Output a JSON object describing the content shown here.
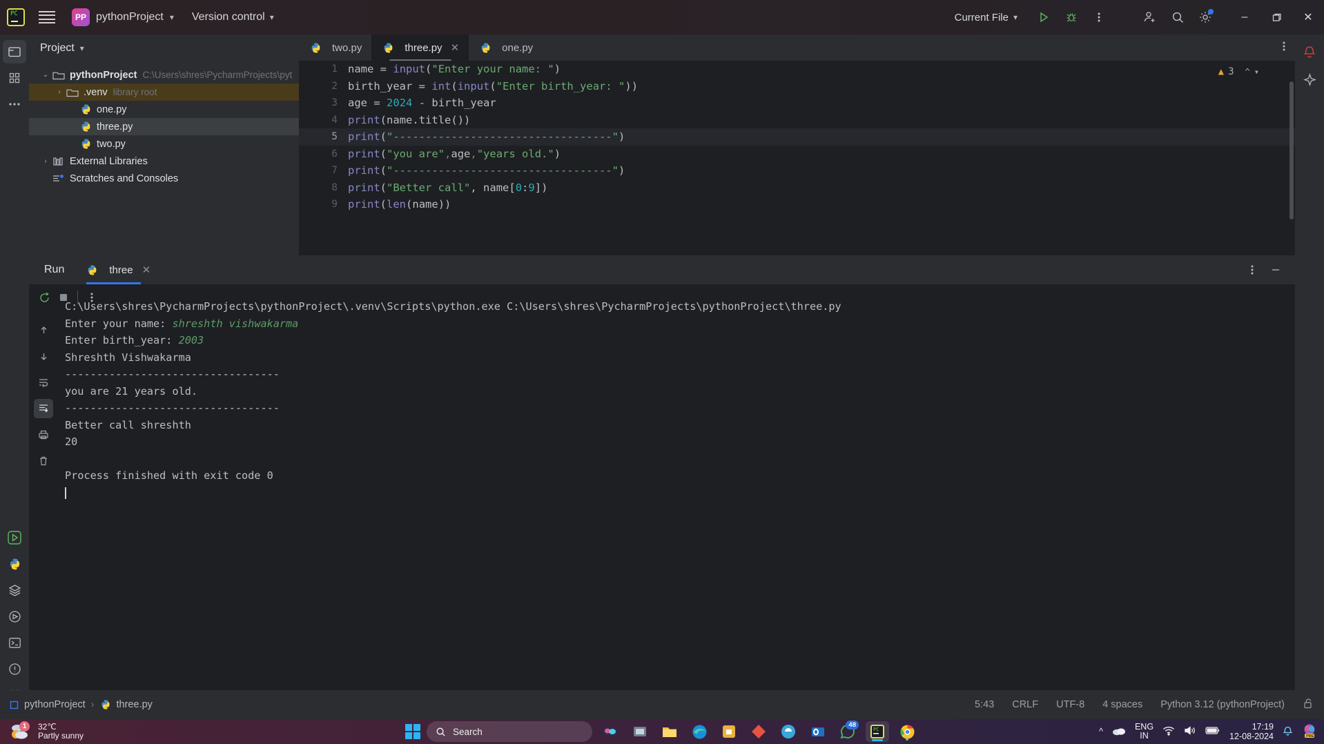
{
  "titlebar": {
    "logo_icon": "pycharm-logo-icon",
    "menu_icon": "hamburger-menu-icon",
    "project_initials": "PP",
    "project_name": "pythonProject",
    "version_control": "Version control",
    "run_config": "Current File",
    "run_icon": "run-triangle-icon",
    "debug_icon": "debug-bug-icon",
    "more_icon": "more-vertical-icon",
    "account_icon": "add-user-icon",
    "search_icon": "search-icon",
    "settings_icon": "gear-icon",
    "minimize": "–",
    "maximize": "❐",
    "close": "✕"
  },
  "toolstrip": {
    "items": [
      {
        "name": "project-icon",
        "label": "Project"
      },
      {
        "name": "structure-icon",
        "label": "Structure"
      },
      {
        "name": "more-tool-windows-icon",
        "label": "More"
      }
    ],
    "bottom": [
      {
        "name": "run-icon",
        "label": "Run"
      },
      {
        "name": "python-console-icon",
        "label": "Python Console"
      },
      {
        "name": "packages-icon",
        "label": "Python Packages"
      },
      {
        "name": "services-icon",
        "label": "Services"
      },
      {
        "name": "terminal-icon",
        "label": "Terminal"
      },
      {
        "name": "problems-icon",
        "label": "Problems"
      },
      {
        "name": "version-control-icon",
        "label": "Version Control"
      }
    ]
  },
  "right_strip": {
    "notifications_icon": "bell-icon",
    "ai_icon": "ai-assistant-icon"
  },
  "project_panel": {
    "title": "Project",
    "caret": "⌄",
    "tree": [
      {
        "indent": 0,
        "arrow": "⌄",
        "icon": "folder-icon",
        "label": "pythonProject",
        "suffix": "C:\\Users\\shres\\PycharmProjects\\pyt",
        "bold": true,
        "state": "normal"
      },
      {
        "indent": 1,
        "arrow": "›",
        "icon": "folder-icon",
        "label": ".venv",
        "suffix": "library root",
        "bold": false,
        "state": "highlight"
      },
      {
        "indent": 2,
        "arrow": "",
        "icon": "python-file-icon",
        "label": "one.py",
        "suffix": "",
        "bold": false,
        "state": "normal"
      },
      {
        "indent": 2,
        "arrow": "",
        "icon": "python-file-icon",
        "label": "three.py",
        "suffix": "",
        "bold": false,
        "state": "selected"
      },
      {
        "indent": 2,
        "arrow": "",
        "icon": "python-file-icon",
        "label": "two.py",
        "suffix": "",
        "bold": false,
        "state": "normal"
      },
      {
        "indent": 0,
        "arrow": "›",
        "icon": "library-icon",
        "label": "External Libraries",
        "suffix": "",
        "bold": false,
        "state": "normal"
      },
      {
        "indent": 0,
        "arrow": "",
        "icon": "scratches-icon",
        "label": "Scratches and Consoles",
        "suffix": "",
        "bold": false,
        "state": "normal"
      }
    ]
  },
  "editor": {
    "tabs": [
      {
        "label": "two.py",
        "icon": "python-file-icon",
        "active": false,
        "closable": false
      },
      {
        "label": "three.py",
        "icon": "python-file-icon",
        "active": true,
        "closable": true
      },
      {
        "label": "one.py",
        "icon": "python-file-icon",
        "active": false,
        "closable": false
      }
    ],
    "tab_close_glyph": "✕",
    "tabbar_more_icon": "more-vertical-icon",
    "inspection": {
      "warning_icon": "warning-triangle-icon",
      "warning_count": "3",
      "up_icon": "chevron-up-icon",
      "down_icon": "chevron-down-icon"
    },
    "current_line": 5,
    "line_numbers": [
      "1",
      "2",
      "3",
      "4",
      "5",
      "6",
      "7",
      "8",
      "9"
    ],
    "code": [
      "name = input(\"Enter your name: \")",
      "birth_year = int(input(\"Enter birth_year: \"))",
      "age = 2024 - birth_year",
      "print(name.title())",
      "print(\"----------------------------------\")",
      "print(\"you are\",age,\"years old.\")",
      "print(\"----------------------------------\")",
      "print(\"Better call\", name[0:9])",
      "print(len(name))"
    ]
  },
  "run_panel": {
    "title": "Run",
    "tab_label": "three",
    "tab_icon": "python-file-icon",
    "tab_close": "✕",
    "options_icon": "more-vertical-icon",
    "minimize_icon": "minimize-icon",
    "toolbar": [
      {
        "name": "rerun-icon",
        "label": "Rerun"
      },
      {
        "name": "stop-icon",
        "label": "Stop"
      },
      {
        "name": "more-run-options-icon",
        "label": "More"
      }
    ],
    "side_toolbar": [
      {
        "name": "up-arrow-icon",
        "label": "Previous occurrence"
      },
      {
        "name": "down-arrow-icon",
        "label": "Next occurrence"
      },
      {
        "name": "soft-wrap-icon",
        "label": "Soft-Wrap"
      },
      {
        "name": "scroll-to-end-icon",
        "label": "Scroll to end",
        "active": true
      },
      {
        "name": "print-icon",
        "label": "Print"
      },
      {
        "name": "trash-icon",
        "label": "Clear All"
      }
    ],
    "console": [
      {
        "text": "C:\\Users\\shres\\PycharmProjects\\pythonProject\\.venv\\Scripts\\python.exe C:\\Users\\shres\\PycharmProjects\\pythonProject\\three.py",
        "input": ""
      },
      {
        "text": "Enter your name: ",
        "input": "shreshth vishwakarma"
      },
      {
        "text": "Enter birth_year: ",
        "input": "2003"
      },
      {
        "text": "Shreshth Vishwakarma",
        "input": ""
      },
      {
        "text": "----------------------------------",
        "input": ""
      },
      {
        "text": "you are 21 years old.",
        "input": ""
      },
      {
        "text": "----------------------------------",
        "input": ""
      },
      {
        "text": "Better call shreshth",
        "input": ""
      },
      {
        "text": "20",
        "input": ""
      },
      {
        "text": "",
        "input": ""
      },
      {
        "text": "Process finished with exit code 0",
        "input": ""
      }
    ]
  },
  "statusbar": {
    "breadcrumb": [
      {
        "icon": "module-icon",
        "label": "pythonProject"
      },
      {
        "icon": "python-file-icon",
        "label": "three.py"
      }
    ],
    "separator": "›",
    "caret_position": "5:43",
    "line_separator": "CRLF",
    "encoding": "UTF-8",
    "indent": "4 spaces",
    "interpreter": "Python 3.12 (pythonProject)",
    "lock_icon": "unlocked-padlock-icon"
  },
  "taskbar": {
    "weather": {
      "temp": "32℃",
      "desc": "Partly sunny",
      "badge": "1",
      "icon": "partly-sunny-icon"
    },
    "start_icon": "windows-logo-icon",
    "search_placeholder": "Search",
    "search_icon": "search-icon",
    "apps": [
      {
        "name": "copilot-icon",
        "label": "Copilot",
        "badge": "",
        "active": false
      },
      {
        "name": "task-view-icon",
        "label": "Task View",
        "badge": "",
        "active": false
      },
      {
        "name": "file-explorer-icon",
        "label": "File Explorer",
        "badge": "",
        "active": false
      },
      {
        "name": "edge-icon",
        "label": "Microsoft Edge",
        "badge": "",
        "active": false
      },
      {
        "name": "store-icon",
        "label": "Microsoft Store",
        "badge": "",
        "active": false
      },
      {
        "name": "app-red-icon",
        "label": "App",
        "badge": "",
        "active": false
      },
      {
        "name": "news-icon",
        "label": "News",
        "badge": "",
        "active": false
      },
      {
        "name": "outlook-icon",
        "label": "Outlook",
        "badge": "",
        "active": false
      },
      {
        "name": "whatsapp-icon",
        "label": "WhatsApp",
        "badge": "48",
        "active": false
      },
      {
        "name": "pycharm-icon",
        "label": "PyCharm",
        "badge": "",
        "active": true
      },
      {
        "name": "chrome-icon",
        "label": "Google Chrome",
        "badge": "",
        "active": false
      }
    ],
    "tray": {
      "chevron_icon": "show-hidden-icons-icon",
      "onedrive_icon": "onedrive-icon",
      "language_line1": "ENG",
      "language_line2": "IN",
      "wifi_icon": "wifi-icon",
      "volume_icon": "volume-icon",
      "battery_icon": "battery-icon",
      "time": "17:19",
      "date": "12-08-2024",
      "bell_icon": "notifications-bell-icon",
      "designer_icon": "designer-pre-icon"
    }
  }
}
